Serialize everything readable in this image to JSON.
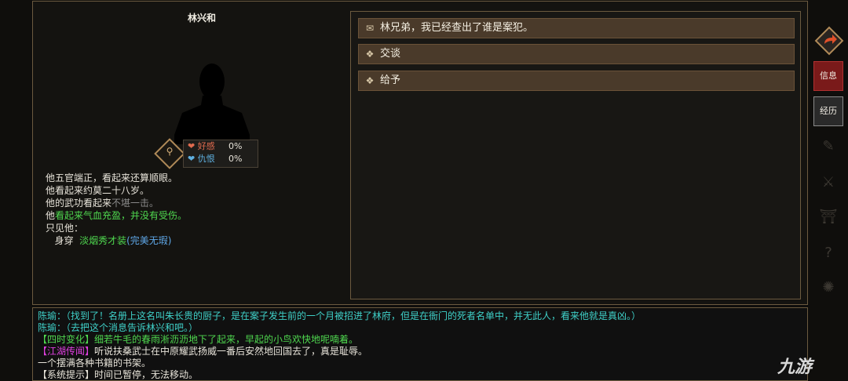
{
  "npc": {
    "name": "林兴和",
    "affinity": {
      "like_label": "好感",
      "like_value": "0%",
      "hate_label": "仇恨",
      "hate_value": "0%"
    },
    "description": {
      "line1": "他五官端正，看起来还算顺眼。",
      "line2": "他看起来约莫二十八岁。",
      "line3_prefix": "他的武功看起来",
      "line3_value": "不堪一击。",
      "line4_prefix": "他",
      "line4_value": "看起来气血充盈，并没有受伤。",
      "line5": "只见他：",
      "wear_label": "身穿",
      "wear_item": "淡烟秀才装",
      "wear_quality": "(完美无瑕)"
    }
  },
  "dialog": {
    "options": [
      {
        "icon": "scroll-icon",
        "label": "林兄弟，我已经查出了谁是案犯。"
      },
      {
        "icon": "diamond-icon",
        "label": "交谈"
      },
      {
        "icon": "diamond-icon",
        "label": "给予"
      }
    ]
  },
  "sidebar": {
    "info_label": "信息",
    "history_label": "经历"
  },
  "log": {
    "line1": "陈瑜：（找到了！名册上这名叫朱长贵的厨子，是在案子发生前的一个月被招进了林府，但是在衙门的死者名单中，并无此人，看来他就是真凶。）",
    "line2": "陈瑜：（去把这个消息告诉林兴和吧。）",
    "line3_tag": "【四时变化】",
    "line3_text": "细若牛毛的春雨淅沥沥地下了起来，早起的小鸟欢快地呢喃着。",
    "line4_tag": "【江湖传闻】",
    "line4_text": "听说扶桑武士在中原耀武扬威一番后安然地回国去了，真是耻辱。",
    "line5": "一个摆满各种书籍的书架。",
    "line6_tag": "【系统提示】",
    "line6_text": "时间已暂停，无法移动。"
  },
  "watermark": "九游"
}
